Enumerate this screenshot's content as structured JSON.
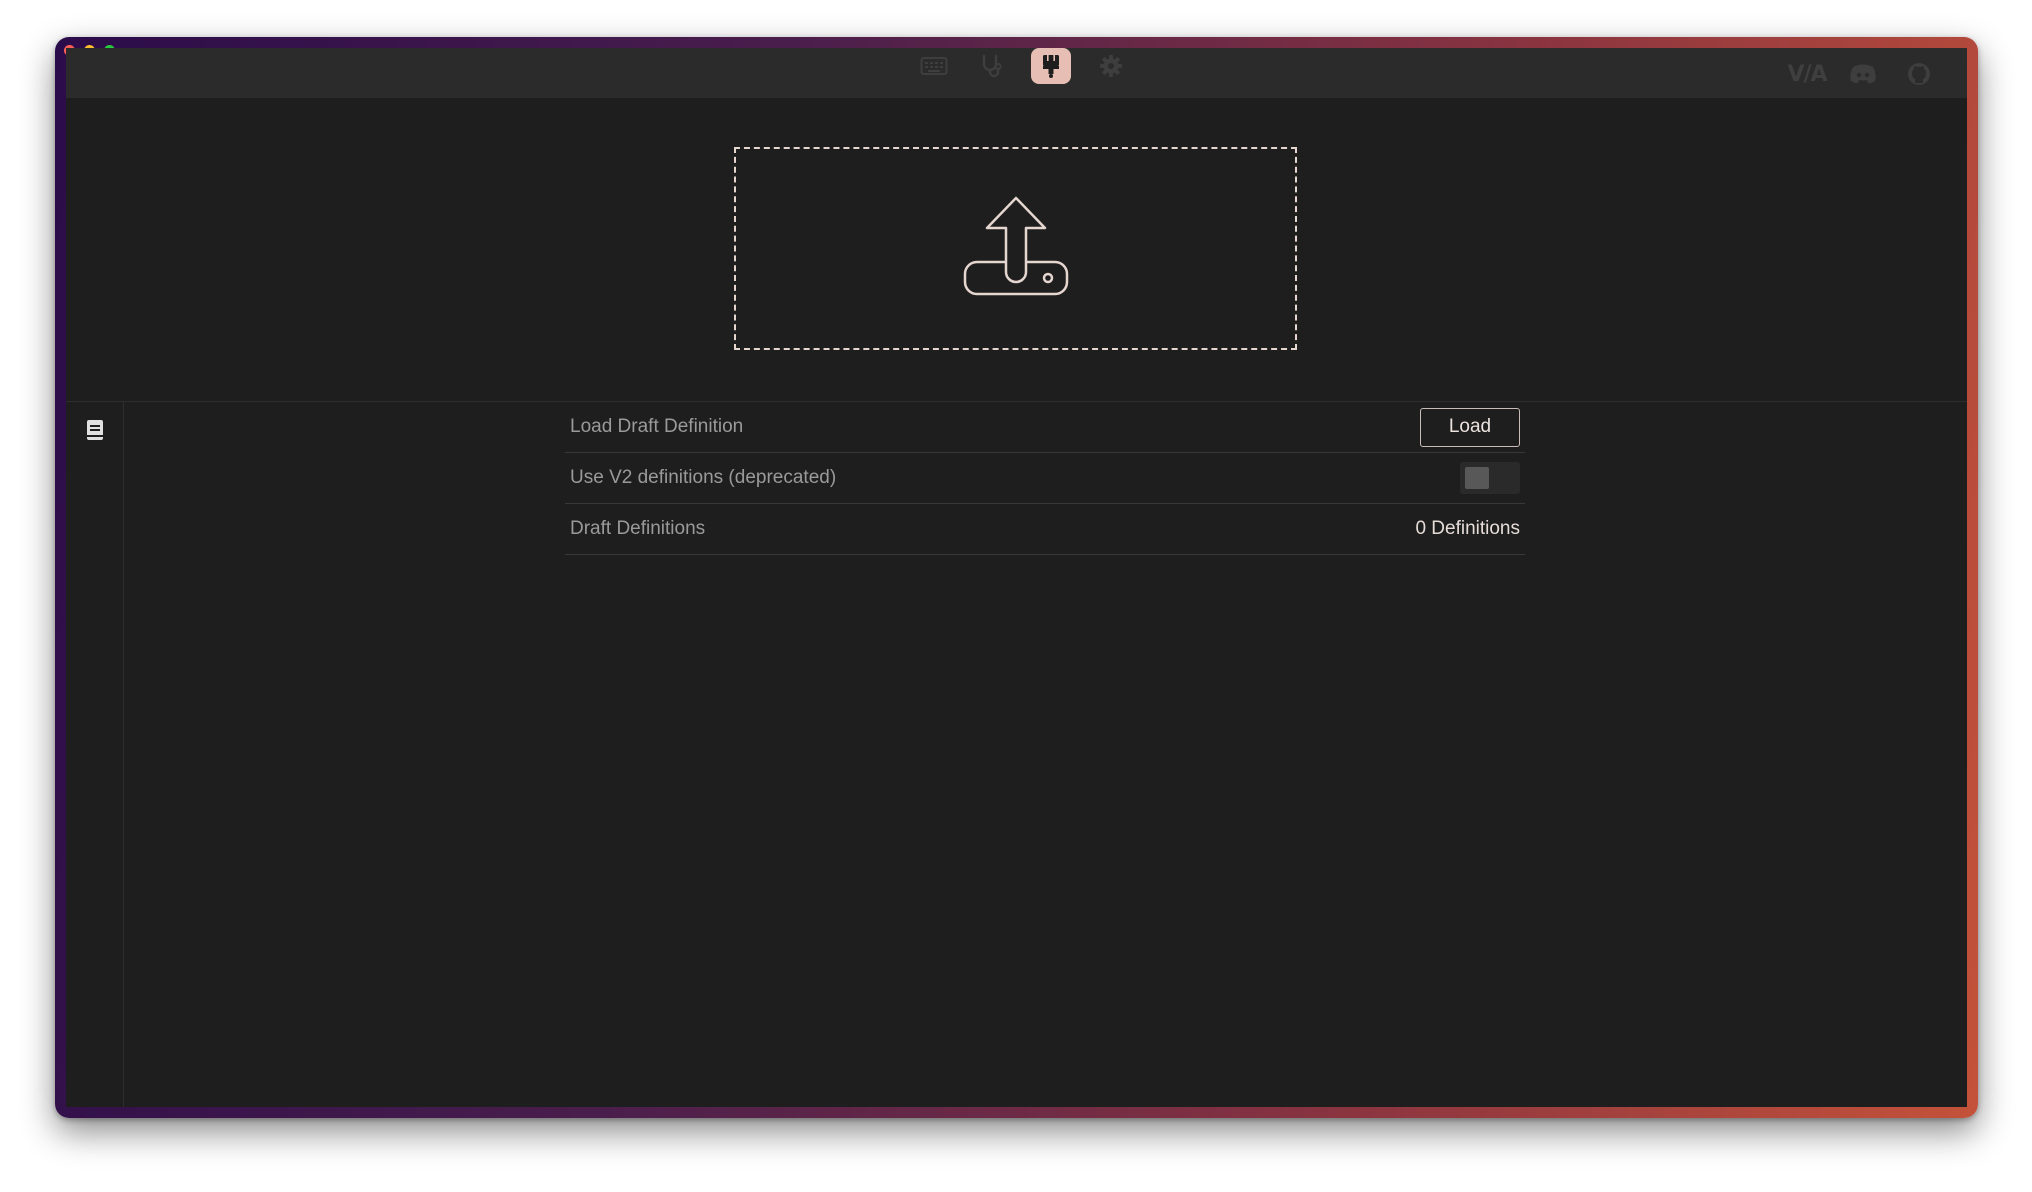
{
  "nav": {
    "items": [
      {
        "name": "configure",
        "icon": "keyboard-icon",
        "active": false
      },
      {
        "name": "test",
        "icon": "stethoscope-icon",
        "active": false
      },
      {
        "name": "design",
        "icon": "paint-brush-icon",
        "active": true
      },
      {
        "name": "settings",
        "icon": "gear-icon",
        "active": false
      }
    ],
    "external": [
      {
        "icon": "via-logo",
        "label": "V/A"
      },
      {
        "icon": "discord-icon"
      },
      {
        "icon": "github-icon"
      }
    ]
  },
  "dropzone": {
    "icon": "upload-icon"
  },
  "sidebar": {
    "items": [
      {
        "icon": "document-icon"
      }
    ]
  },
  "settings": {
    "load_draft": {
      "label": "Load Draft Definition",
      "button_label": "Load"
    },
    "use_v2": {
      "label": "Use V2 definitions (deprecated)",
      "enabled": false
    },
    "draft_definitions": {
      "label": "Draft Definitions",
      "value": "0 Definitions"
    }
  },
  "colors": {
    "accent": "#e6beb4",
    "panel_bg": "#1e1e1e",
    "topbar_bg": "#2b2b2b",
    "muted_icon": "#3e3e3e"
  }
}
